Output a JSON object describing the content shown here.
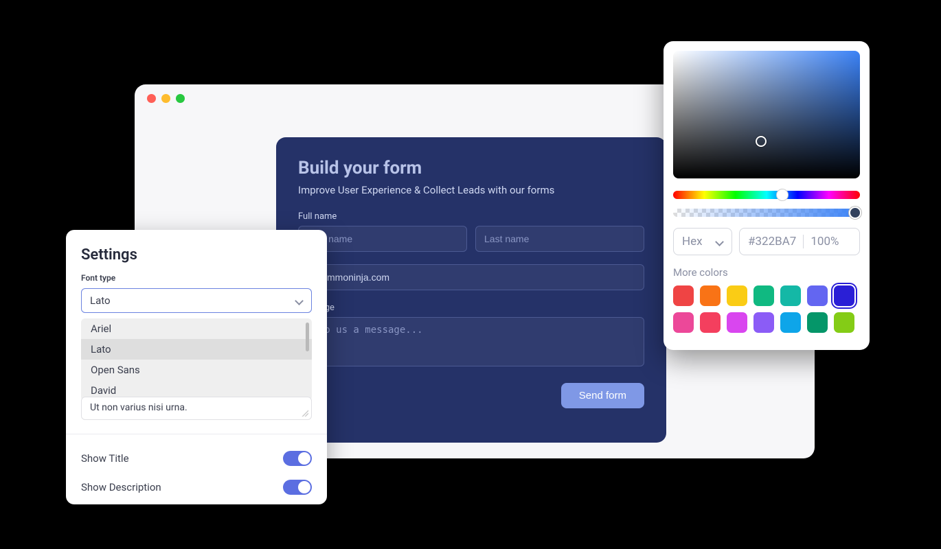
{
  "window": {
    "form": {
      "title": "Build your form",
      "subtitle": "Improve User Experience & Collect Leads with our forms",
      "fields": {
        "full_name_label": "Full name",
        "first_name_placeholder": "First name",
        "last_name_placeholder": "Last name",
        "email_value": "@commoninja.com",
        "message_label": "Message",
        "message_placeholder": "Drop us a message..."
      },
      "submit_label": "Send form"
    }
  },
  "settings": {
    "title": "Settings",
    "font_type_label": "Font type",
    "font_selected": "Lato",
    "font_options": [
      "Ariel",
      "Lato",
      "Open Sans",
      "David"
    ],
    "textarea_value": "Ut non varius nisi urna.",
    "show_title_label": "Show Title",
    "show_title_value": true,
    "show_description_label": "Show Description",
    "show_description_value": true
  },
  "picker": {
    "format_label": "Hex",
    "hex_value": "#322BA7",
    "opacity_value": "100%",
    "more_colors_label": "More colors",
    "swatches": [
      "#ef4444",
      "#f97316",
      "#facc15",
      "#10b981",
      "#14b8a6",
      "#6366f1",
      "#2a1fd6",
      "#ec4899",
      "#f43f5e",
      "#d946ef",
      "#8b5cf6",
      "#0ea5e9",
      "#059669",
      "#84cc16"
    ],
    "selected_swatch_index": 6
  }
}
